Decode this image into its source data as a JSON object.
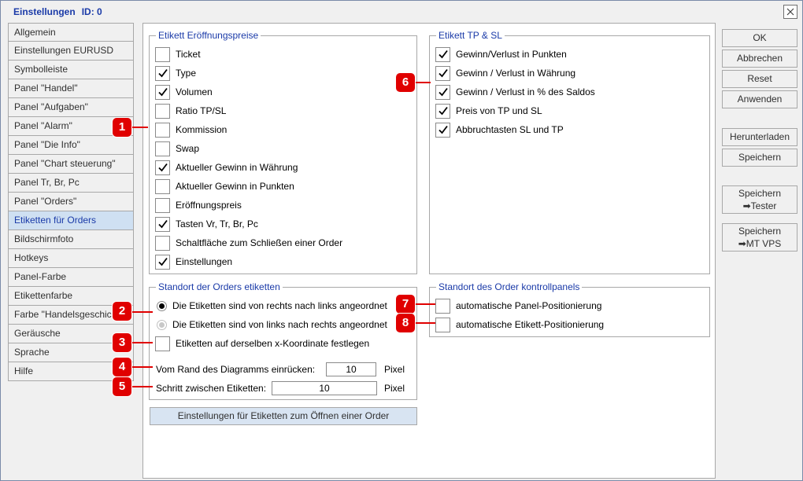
{
  "window": {
    "title": "Einstellungen",
    "id_label": "ID: 0"
  },
  "sidebar": {
    "items": [
      {
        "label": "Allgemein",
        "active": false
      },
      {
        "label": "Einstellungen EURUSD",
        "active": false
      },
      {
        "label": "Symbolleiste",
        "active": false
      },
      {
        "label": "Panel \"Handel\"",
        "active": false
      },
      {
        "label": "Panel \"Aufgaben\"",
        "active": false
      },
      {
        "label": "Panel \"Alarm\"",
        "active": false
      },
      {
        "label": "Panel \"Die Info\"",
        "active": false
      },
      {
        "label": "Panel \"Chart steuerung\"",
        "active": false
      },
      {
        "label": "Panel Tr, Br, Pc",
        "active": false
      },
      {
        "label": "Panel \"Orders\"",
        "active": false
      },
      {
        "label": "Etiketten für Orders",
        "active": true
      },
      {
        "label": "Bildschirmfoto",
        "active": false
      },
      {
        "label": "Hotkeys",
        "active": false
      },
      {
        "label": "Panel-Farbe",
        "active": false
      },
      {
        "label": "Etikettenfarbe",
        "active": false
      },
      {
        "label": "Farbe \"Handelsgeschichte\"",
        "active": false
      },
      {
        "label": "Geräusche",
        "active": false
      },
      {
        "label": "Sprache",
        "active": false
      },
      {
        "label": "Hilfe",
        "active": false
      }
    ]
  },
  "opening_prices": {
    "legend": "Etikett Eröffnungspreise",
    "items": [
      {
        "label": "Ticket",
        "checked": false
      },
      {
        "label": "Type",
        "checked": true
      },
      {
        "label": "Volumen",
        "checked": true
      },
      {
        "label": "Ratio TP/SL",
        "checked": false
      },
      {
        "label": "Kommission",
        "checked": false
      },
      {
        "label": "Swap",
        "checked": false
      },
      {
        "label": "Aktueller Gewinn in Währung",
        "checked": true
      },
      {
        "label": "Aktueller Gewinn in Punkten",
        "checked": false
      },
      {
        "label": "Eröffnungspreis",
        "checked": false
      },
      {
        "label": "Tasten Vr, Tr, Br, Pc",
        "checked": true
      },
      {
        "label": "Schaltfläche zum Schließen einer Order",
        "checked": false
      },
      {
        "label": "Einstellungen",
        "checked": true
      }
    ]
  },
  "tp_sl": {
    "legend": "Etikett TP & SL",
    "items": [
      {
        "label": "Gewinn/Verlust in Punkten",
        "checked": true
      },
      {
        "label": "Gewinn / Verlust in Währung",
        "checked": true
      },
      {
        "label": "Gewinn / Verlust in % des Saldos",
        "checked": true
      },
      {
        "label": "Preis von TP und SL",
        "checked": true
      },
      {
        "label": "Abbruchtasten SL und TP",
        "checked": true
      }
    ]
  },
  "location": {
    "legend": "Standort der Orders etiketten",
    "radio_right_to_left": "Die Etiketten sind von rechts nach links angeordnet",
    "radio_left_to_right": "Die Etiketten sind von links nach rechts angeordnet",
    "same_x_label": "Etiketten auf derselben x-Koordinate festlegen",
    "same_x_checked": false,
    "indent_label": "Vom Rand des Diagramms einrücken:",
    "indent_value": "10",
    "indent_unit": "Pixel",
    "step_label": "Schritt zwischen Etiketten:",
    "step_value": "10",
    "step_unit": "Pixel"
  },
  "control_panel_location": {
    "legend": "Standort des Order kontrollpanels",
    "auto_panel": "automatische Panel-Positionierung",
    "auto_label": "automatische Etikett-Positionierung"
  },
  "open_order_settings_button": "Einstellungen für Etiketten zum Öffnen einer Order",
  "right_buttons": {
    "ok": "OK",
    "cancel": "Abbrechen",
    "reset": "Reset",
    "apply": "Anwenden",
    "download": "Herunterladen",
    "save": "Speichern",
    "save_tester_line1": "Speichern",
    "save_tester_line2": "➡Tester",
    "save_vps_line1": "Speichern",
    "save_vps_line2": "➡MT VPS"
  },
  "callouts": [
    "1",
    "2",
    "3",
    "4",
    "5",
    "6",
    "7",
    "8"
  ],
  "colors": {
    "accent_blue": "#1a3aa8",
    "callout_red": "#e00000",
    "active_item_bg": "#cfe0f2"
  }
}
